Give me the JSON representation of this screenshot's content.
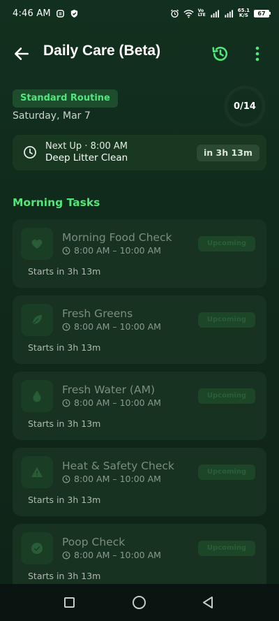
{
  "status_bar": {
    "time": "4:46 AM",
    "net_speed_value": "65.1",
    "net_speed_unit": "K/S",
    "volte_top": "Vo",
    "volte_bottom": "LTE",
    "battery": "67"
  },
  "app_bar": {
    "title": "Daily Care (Beta)",
    "back_icon": "arrow-left-icon",
    "history_icon": "history-icon",
    "more_icon": "more-vertical-icon"
  },
  "header": {
    "routine_badge": "Standard Routine",
    "date": "Saturday, Mar 7",
    "progress_text": "0/14",
    "progress_fraction": 0
  },
  "next_up": {
    "label": "Next Up · 8:00 AM",
    "task": "Deep Litter Clean",
    "eta": "in 3h 13m"
  },
  "section": {
    "title": "Morning Tasks"
  },
  "tasks": [
    {
      "name": "Morning Food Check",
      "time": "8:00 AM – 10:00 AM",
      "starts": "Starts in 3h 13m",
      "icon": "heart-icon",
      "status": "Upcoming"
    },
    {
      "name": "Fresh Greens",
      "time": "8:00 AM – 10:00 AM",
      "starts": "Starts in 3h 13m",
      "icon": "leaf-icon",
      "status": "Upcoming"
    },
    {
      "name": "Fresh Water (AM)",
      "time": "8:00 AM – 10:00 AM",
      "starts": "Starts in 3h 13m",
      "icon": "water-drop-icon",
      "status": "Upcoming"
    },
    {
      "name": "Heat & Safety Check",
      "time": "8:00 AM – 10:00 AM",
      "starts": "Starts in 3h 13m",
      "icon": "warning-icon",
      "status": "Upcoming"
    },
    {
      "name": "Poop Check",
      "time": "8:00 AM – 10:00 AM",
      "starts": "Starts in 3h 13m",
      "icon": "check-circle-icon",
      "status": "Upcoming"
    }
  ],
  "colors": {
    "accent": "#4ee87a",
    "background": "#0f2418",
    "card": "#173220"
  }
}
